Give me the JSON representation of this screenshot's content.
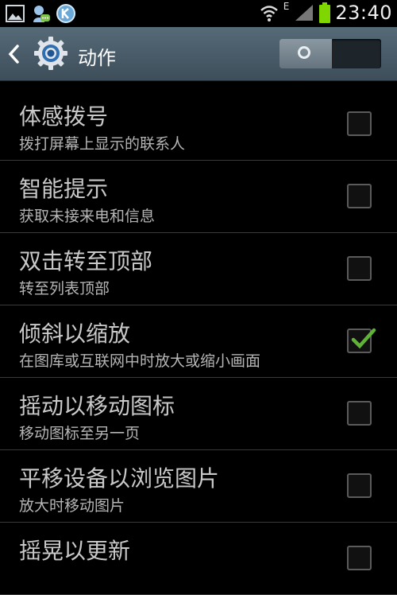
{
  "status_bar": {
    "time": "23:40",
    "network_label": "E",
    "icons": [
      "image-icon",
      "chat-icon",
      "k-app-icon",
      "wifi-icon",
      "signal-icon",
      "battery-icon"
    ],
    "colors": {
      "battery": "#7fd600"
    }
  },
  "header": {
    "title": "动作",
    "toggle_state": "on"
  },
  "settings": [
    {
      "title": "体感拨号",
      "subtitle": "拨打屏幕上显示的联系人",
      "checked": false
    },
    {
      "title": "智能提示",
      "subtitle": "获取未接来电和信息",
      "checked": false
    },
    {
      "title": "双击转至顶部",
      "subtitle": "转至列表顶部",
      "checked": false
    },
    {
      "title": "倾斜以缩放",
      "subtitle": "在图库或互联网中时放大或缩小画面",
      "checked": true
    },
    {
      "title": "摇动以移动图标",
      "subtitle": "移动图标至另一页",
      "checked": false
    },
    {
      "title": "平移设备以浏览图片",
      "subtitle": "放大时移动图片",
      "checked": false
    },
    {
      "title": "摇晃以更新",
      "subtitle": "",
      "checked": false
    }
  ],
  "colors": {
    "accent_check": "#5fb336",
    "header_bg": "#4b5d6a"
  }
}
